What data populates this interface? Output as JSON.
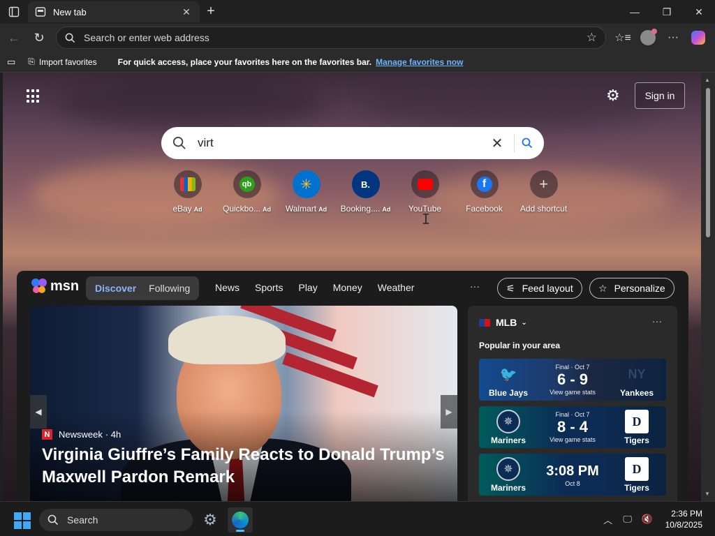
{
  "browser": {
    "tab_title": "New tab",
    "address_placeholder": "Search or enter web address"
  },
  "favorites_bar": {
    "import_label": "Import favorites",
    "hint": "For quick access, place your favorites here on the favorites bar.",
    "manage_link": "Manage favorites now"
  },
  "newtab": {
    "sign_in": "Sign in",
    "search_value": "virt",
    "shortcuts": [
      {
        "label": "eBay",
        "ad": "Ad",
        "icon": "ebay-bag-icon"
      },
      {
        "label": "Quickbo...",
        "ad": "Ad",
        "icon": "quickbooks-icon"
      },
      {
        "label": "Walmart",
        "ad": "Ad",
        "icon": "walmart-spark-icon"
      },
      {
        "label": "Booking....",
        "ad": "Ad",
        "icon": "booking-icon"
      },
      {
        "label": "YouTube",
        "ad": "",
        "icon": "youtube-icon"
      },
      {
        "label": "Facebook",
        "ad": "",
        "icon": "facebook-icon"
      },
      {
        "label": "Add shortcut",
        "ad": "",
        "icon": "plus-icon"
      }
    ]
  },
  "feed": {
    "brand": "msn",
    "segments": [
      "Discover",
      "Following"
    ],
    "links": [
      "News",
      "Sports",
      "Play",
      "Money",
      "Weather"
    ],
    "more": "···",
    "feed_layout": "Feed layout",
    "personalize": "Personalize",
    "hero": {
      "source": "Newsweek",
      "age": "· 4h",
      "title": "Virginia Giuffre’s Family Reacts to Donald Trump’s Maxwell Pardon Remark"
    },
    "mlb": {
      "title": "MLB",
      "subtitle": "Popular in your area",
      "games": [
        {
          "status": "Final · Oct 7",
          "score": "6 - 9",
          "stats": "View game stats",
          "left": "Blue Jays",
          "right": "Yankees"
        },
        {
          "status": "Final · Oct 7",
          "score": "8 - 4",
          "stats": "View game stats",
          "left": "Mariners",
          "right": "Tigers"
        },
        {
          "status": "",
          "score": "3:08 PM",
          "stats": "Oct 8",
          "left": "Mariners",
          "right": "Tigers"
        }
      ]
    }
  },
  "taskbar": {
    "search": "Search",
    "time": "2:36 PM",
    "date": "10/8/2025"
  },
  "colors": {
    "accent_link": "#6cb4ff",
    "taskbar": "#1c1c1c",
    "toolbar": "#2b2b2b"
  }
}
